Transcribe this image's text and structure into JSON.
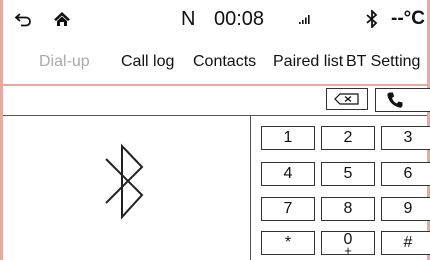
{
  "statusbar": {
    "back_icon": "back-arrow-icon",
    "home_icon": "home-icon",
    "network": "N",
    "time": "00:08",
    "signal_icon": "signal-icon",
    "bluetooth_icon": "bluetooth-icon",
    "temperature": "--°C"
  },
  "tabs": [
    {
      "label": "Dial-up",
      "active": true
    },
    {
      "label": "Call log",
      "active": false
    },
    {
      "label": "Contacts",
      "active": false
    },
    {
      "label": "Paired list",
      "active": false
    },
    {
      "label": "BT Setting",
      "active": false
    }
  ],
  "dialer": {
    "number": "",
    "backspace_icon": "backspace-icon",
    "call_icon": "phone-icon"
  },
  "bluetooth_logo": "bluetooth-logo",
  "keypad": {
    "keys": [
      {
        "main": "1",
        "sub": ""
      },
      {
        "main": "2",
        "sub": ""
      },
      {
        "main": "3",
        "sub": ""
      },
      {
        "main": "4",
        "sub": ""
      },
      {
        "main": "5",
        "sub": ""
      },
      {
        "main": "6",
        "sub": ""
      },
      {
        "main": "7",
        "sub": ""
      },
      {
        "main": "8",
        "sub": ""
      },
      {
        "main": "9",
        "sub": ""
      },
      {
        "main": "*",
        "sub": ""
      },
      {
        "main": "0",
        "sub": "+"
      },
      {
        "main": "#",
        "sub": ""
      }
    ]
  },
  "colors": {
    "frame_border": "#e8a9a0",
    "active_tab": "#aaaaaa",
    "text": "#111111"
  }
}
